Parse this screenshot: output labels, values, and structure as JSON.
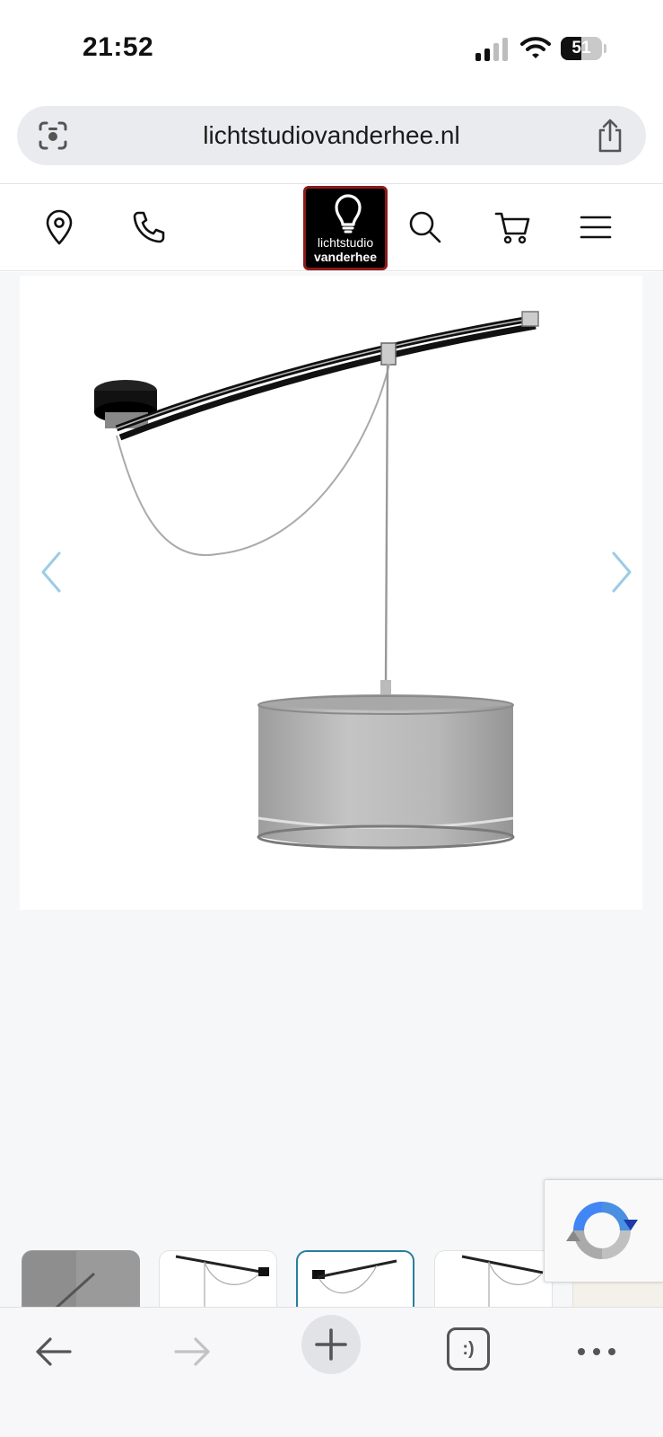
{
  "status_bar": {
    "time": "21:52",
    "battery_level": "51",
    "battery_fraction": 0.51,
    "icons": [
      "cellular-signal-icon",
      "wifi-icon",
      "battery-icon"
    ]
  },
  "browser": {
    "url": "lichtstudiovanderhee.nl",
    "icons": [
      "visual-search-icon",
      "share-icon"
    ]
  },
  "site_header": {
    "logo_line1": "lichtstudio",
    "logo_line2": "vanderhee",
    "icons": [
      "location-pin-icon",
      "phone-icon",
      "search-icon",
      "cart-icon",
      "hamburger-menu-icon"
    ]
  },
  "gallery": {
    "thumbnail_count_visible": 5,
    "active_thumbnail": 3,
    "icons": [
      "chevron-left-icon",
      "chevron-right-icon"
    ]
  },
  "toolbar": {
    "icons": [
      "back-arrow-icon",
      "forward-arrow-icon",
      "new-tab-plus-icon",
      "tab-switcher-icon",
      "more-dots-icon"
    ],
    "tab_switcher_label": ":)"
  },
  "colors": {
    "accent": "#2a7ea0",
    "arrow": "#9ccbe6",
    "logo_bg": "#000000",
    "logo_border": "#8a1a1a",
    "gallery_bg": "#f5f7f9"
  }
}
